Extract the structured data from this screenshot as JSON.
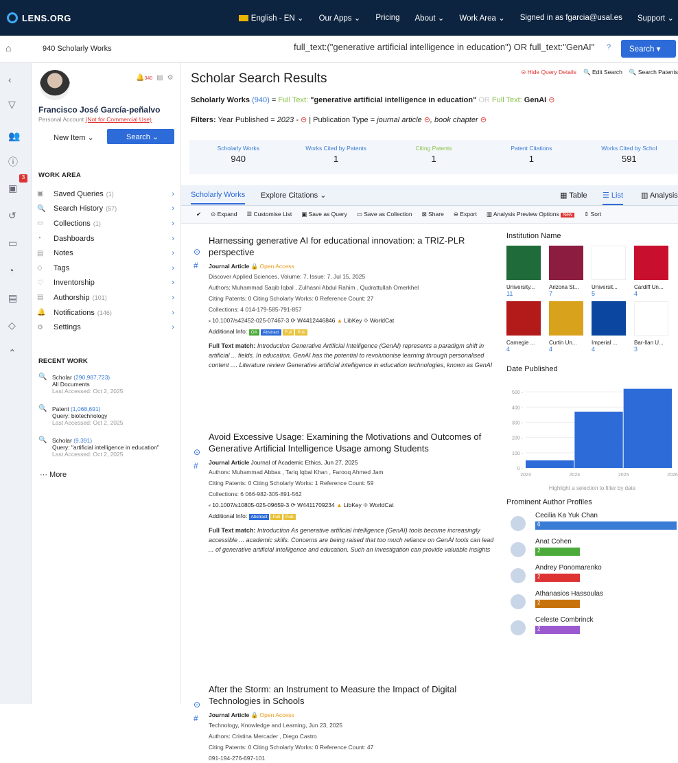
{
  "topbar": {
    "brand": "LENS.ORG",
    "language": "English - EN",
    "our_apps": "Our Apps",
    "pricing": "Pricing",
    "about": "About",
    "work_area": "Work Area",
    "signed_in": "Signed in as fgarcia@usal.es",
    "support": "Support"
  },
  "searchbar": {
    "count_label": "940 Scholarly Works",
    "query": "full_text:(\"generative artificial intelligence in education\") OR full_text:\"GenAI\"",
    "help": "?",
    "search_button": "Search"
  },
  "left_rail": {
    "filter_badge": "3"
  },
  "user": {
    "name": "Francisco José García-peñalvo",
    "account": "Personal Account",
    "account_note": "(Not for Commercial Use)",
    "notif_count": "340",
    "new_item": "New Item",
    "search": "Search"
  },
  "work_area": {
    "title": "WORK AREA",
    "items": [
      {
        "label": "Saved Queries",
        "count": "(1)"
      },
      {
        "label": "Search History",
        "count": "(57)"
      },
      {
        "label": "Collections",
        "count": "(1)"
      },
      {
        "label": "Dashboards",
        "count": ""
      },
      {
        "label": "Notes",
        "count": ""
      },
      {
        "label": "Tags",
        "count": ""
      },
      {
        "label": "Inventorship",
        "count": ""
      },
      {
        "label": "Authorship",
        "count": "(101)"
      },
      {
        "label": "Notifications",
        "count": "(146)"
      },
      {
        "label": "Settings",
        "count": ""
      }
    ]
  },
  "recent_work": {
    "title": "RECENT WORK",
    "items": [
      {
        "type": "Scholar",
        "count": "(290,987,723)",
        "query": "All Documents",
        "accessed": "Last Accessed: Oct 2, 2025"
      },
      {
        "type": "Patent",
        "count": "(1,068,691)",
        "query": "Query: biotechnology",
        "accessed": "Last Accessed: Oct 2, 2025"
      },
      {
        "type": "Scholar",
        "count": "(9,391)",
        "query": "Query: \"artificial intelligence in education\"",
        "accessed": "Last Accessed: Oct 2, 2025"
      }
    ],
    "more": "More"
  },
  "main": {
    "title": "Scholar Search Results",
    "hide_query": "Hide Query Details",
    "edit_search": "Edit Search",
    "search_patents": "Search Patents",
    "query_summary": {
      "label": "Scholarly Works",
      "count": "(940)",
      "eq": "=",
      "ft1": "Full Text:",
      "phrase": "\"generative artificial intelligence in education\"",
      "or": "OR",
      "ft2": "Full Text:",
      "term": "GenAI"
    },
    "filters": {
      "label": "Filters:",
      "year_label": "Year Published =",
      "year_value": "2023 -",
      "type_label": "Publication Type =",
      "type_value": "journal article",
      "type_value2": ", book chapter"
    },
    "stats": [
      {
        "label": "Scholarly Works",
        "value": "940"
      },
      {
        "label": "Works Cited by Patents",
        "value": "1"
      },
      {
        "label": "Citing Patents",
        "value": "1"
      },
      {
        "label": "Patent Citations",
        "value": "1"
      },
      {
        "label": "Works Cited by Schol",
        "value": "591"
      }
    ],
    "tabs": {
      "scholarly": "Scholarly Works",
      "citations": "Explore Citations",
      "table": "Table",
      "list": "List",
      "analysis": "Analysis"
    },
    "toolbar": {
      "expand": "Expand",
      "customise": "Customise List",
      "save_query": "Save as Query",
      "save_collection": "Save as Collection",
      "share": "Share",
      "export": "Export",
      "analysis_preview": "Analysis Preview Options",
      "new": "New",
      "sort": "Sort"
    }
  },
  "results": [
    {
      "title": "Harnessing generative AI for educational innovation: a TRIZ-PLR perspective",
      "type": "Journal Article",
      "oa": "Open Access",
      "source": "Discover Applied Sciences,  Volume: 7,  Issue: 7,  Jul 15, 2025",
      "authors": "Authors: Muhammad Saqib Iqbal , Zulhasni Abdul Rahim , Qudrattullah Omerkhel",
      "citing": "Citing Patents: 0      Citing Scholarly Works: 0      Reference Count: 27",
      "collections": "Collections: 4      014-179-585-791-857",
      "doi": "10.1007/s42452-025-07467-3",
      "work_id": "W4412446846",
      "libkey": "LibKey",
      "worldcat": "WorldCat",
      "additional": "Additional Info:",
      "ft_label": "Full Text match:",
      "ft_text": "Introduction Generative Artificial Intelligence (GenAI) represents a paradigm shift in artificial ... fields. In education, GenAI has the potential to revolutionise learning through personalised content .... Literature review Generative artificial intelligence in education technologies, known as GenAI"
    },
    {
      "title": "Avoid Excessive Usage: Examining the Motivations and Outcomes of Generative Artificial Intelligence Usage among Students",
      "type": "Journal Article",
      "oa": "Journal of Academic Ethics,  Jun 27, 2025",
      "source": "",
      "authors": "Authors: Muhammad Abbas , Tariq Iqbal Khan , Farooq Ahmed Jam",
      "citing": "Citing Patents: 0      Citing Scholarly Works: 1      Reference Count: 59",
      "collections": "Collections: 6      066-982-305-891-562",
      "doi": "10.1007/s10805-025-09659-3",
      "work_id": "W4411709234",
      "libkey": "LibKey",
      "worldcat": "WorldCat",
      "additional": "Additional Info:",
      "ft_label": "Full Text match:",
      "ft_text": "Introduction As generative artificial intelligence (GenAI) tools become increasingly accessible ... academic skills. Concerns are being raised that too much reliance on GenAI tools can lead ... of generative artificial intelligence and education. Such an investigation can provide valuable insights"
    },
    {
      "title": "After the Storm: an Instrument to Measure the Impact of Digital Technologies in Schools",
      "type": "Journal Article",
      "oa": "Open Access",
      "source": "Technology, Knowledge and Learning,  Jun 23, 2025",
      "authors": "Authors: Cristina Mercader , Diego Castro",
      "citing": "Citing Patents: 0      Citing Scholarly Works: 0      Reference Count: 47",
      "collections": "091-194-276-697-101"
    }
  ],
  "facets": {
    "institution_title": "Institution Name",
    "institutions": [
      {
        "name": "University...",
        "count": "11"
      },
      {
        "name": "Arizona St...",
        "count": "7"
      },
      {
        "name": "Universit...",
        "count": "5"
      },
      {
        "name": "Cardiff Un...",
        "count": "4"
      },
      {
        "name": "Carnegie ...",
        "count": "4"
      },
      {
        "name": "Curtin Un...",
        "count": "4"
      },
      {
        "name": "Imperial ...",
        "count": "4"
      },
      {
        "name": "Bar-Ilan U...",
        "count": "3"
      }
    ],
    "date_title": "Date Published",
    "date_hint": "Highlight a selection to filter by date",
    "authors_title": "Prominent Author Profiles",
    "authors": [
      {
        "name": "Cecilia Ka Yuk Chan",
        "count": 6,
        "color": "#3a7bd5"
      },
      {
        "name": "Anat Cohen",
        "count": 2,
        "color": "#4caa3a"
      },
      {
        "name": "Andrey Ponomarenko",
        "count": 2,
        "color": "#d33"
      },
      {
        "name": "Athanasios Hassoulas",
        "count": 2,
        "color": "#c8720c"
      },
      {
        "name": "Celeste Combrinck",
        "count": 2,
        "color": "#9b59d0"
      }
    ]
  },
  "chart_data": {
    "type": "bar",
    "categories": [
      "2023",
      "2024",
      "2025"
    ],
    "values": [
      50,
      370,
      520
    ],
    "x_ticks": [
      "2023",
      "2024",
      "2025",
      "2026"
    ],
    "y_ticks": [
      "0",
      "100",
      "200",
      "300",
      "400",
      "500"
    ],
    "ylim": [
      0,
      550
    ],
    "color": "#2d6bd8"
  }
}
